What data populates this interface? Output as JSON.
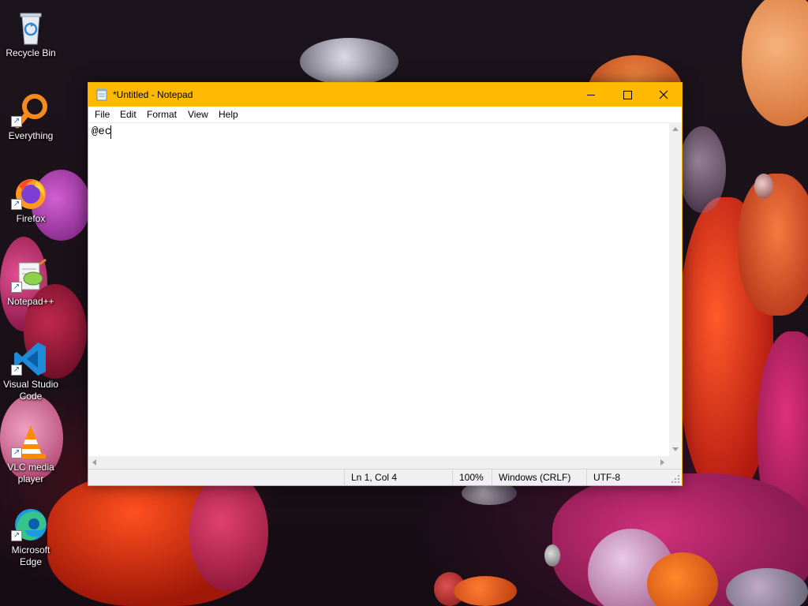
{
  "desktop": {
    "icons": [
      {
        "label": "Recycle Bin",
        "icon": "recycle-bin-icon"
      },
      {
        "label": "Everything",
        "icon": "everything-search-icon"
      },
      {
        "label": "Firefox",
        "icon": "firefox-icon"
      },
      {
        "label": "Notepad++",
        "icon": "notepad-plus-plus-icon"
      },
      {
        "label": "Visual Studio Code",
        "icon": "vscode-icon"
      },
      {
        "label": "VLC media player",
        "icon": "vlc-icon"
      },
      {
        "label": "Microsoft Edge",
        "icon": "edge-icon"
      }
    ]
  },
  "window": {
    "title": "*Untitled - Notepad",
    "accent_color": "#ffb900",
    "controls": {
      "minimize": "minimize-icon",
      "maximize": "maximize-icon",
      "close": "close-icon"
    }
  },
  "menu": {
    "items": [
      "File",
      "Edit",
      "Format",
      "View",
      "Help"
    ]
  },
  "editor": {
    "content": "@ec"
  },
  "status": {
    "position": "Ln 1, Col 4",
    "zoom": "100%",
    "line_ending": "Windows (CRLF)",
    "encoding": "UTF-8"
  }
}
